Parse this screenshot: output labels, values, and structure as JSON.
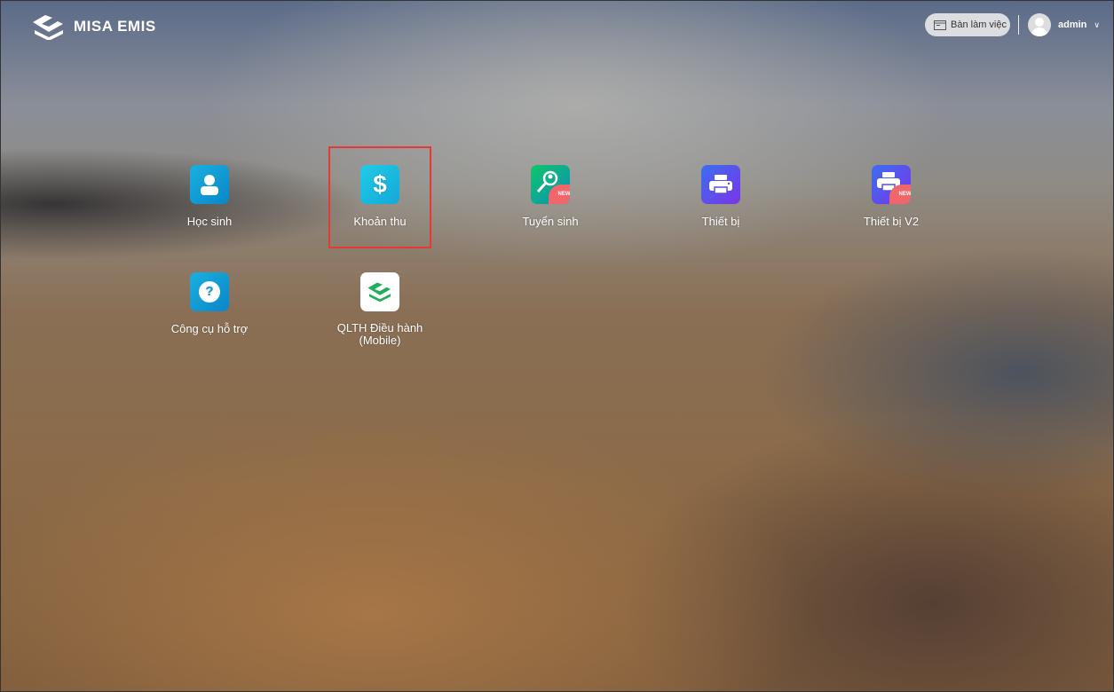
{
  "header": {
    "brand": "MISA EMIS",
    "desk_button": "Bàn làm việc",
    "username": "admin"
  },
  "apps": [
    {
      "label": "Học sinh",
      "icon": "student-icon",
      "badge": null
    },
    {
      "label": "Khoản thu",
      "icon": "dollar-icon",
      "badge": null
    },
    {
      "label": "Tuyển sinh",
      "icon": "recruit-search-icon",
      "badge": "NEW"
    },
    {
      "label": "Thiết bị",
      "icon": "printer-icon",
      "badge": null
    },
    {
      "label": "Thiết bị V2",
      "icon": "printer-icon",
      "badge": "NEW"
    },
    {
      "label": "Công cụ hỗ trợ",
      "icon": "help-icon",
      "badge": null
    },
    {
      "label": "QLTH Điều hành (Mobile)",
      "icon": "misa-logo-icon",
      "badge": null
    }
  ],
  "selected_app": "Khoản thu"
}
